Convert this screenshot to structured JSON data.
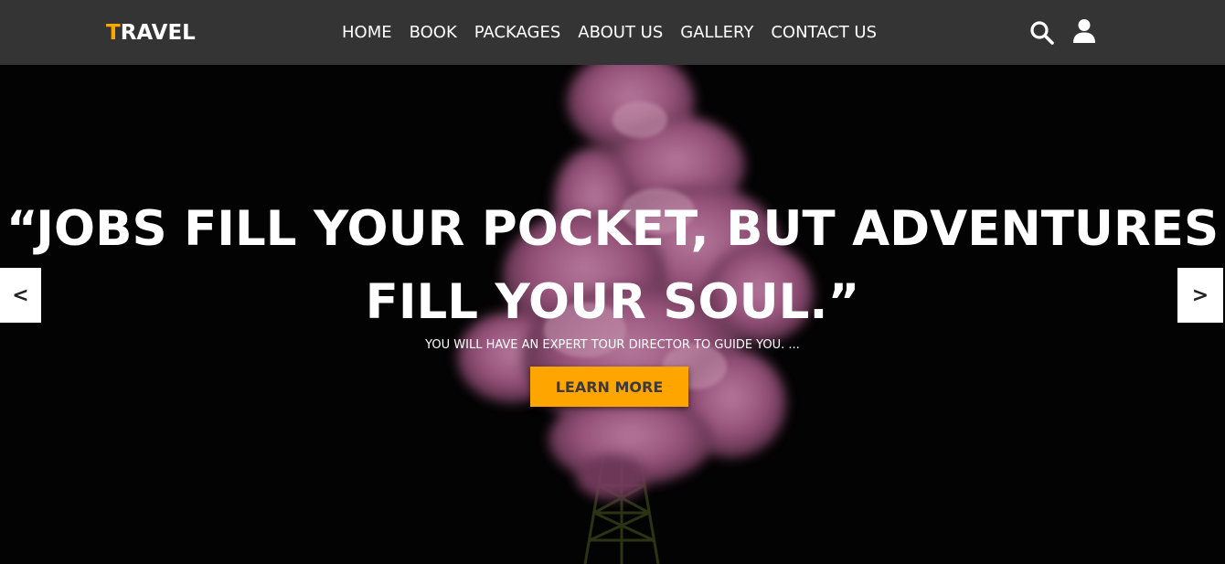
{
  "header": {
    "logo_first": "T",
    "logo_rest": "RAVEL",
    "nav": [
      {
        "label": "HOME"
      },
      {
        "label": "BOOK"
      },
      {
        "label": "PACKAGES"
      },
      {
        "label": "ABOUT US"
      },
      {
        "label": "GALLERY"
      },
      {
        "label": "CONTACT US"
      }
    ],
    "icons": [
      "search-icon",
      "user-icon"
    ]
  },
  "hero": {
    "title_line1": "“JOBS FILL YOUR POCKET, BUT ADVENTURES",
    "title_line2": "FILL YOUR SOUL.”",
    "subtitle": "YOU WILL HAVE AN EXPERT TOUR DIRECTOR TO GUIDE YOU. ...",
    "cta_label": "LEARN MORE",
    "prev_label": "<",
    "next_label": ">"
  },
  "colors": {
    "header_bg": "#343434",
    "accent": "#ffa500",
    "hero_bg": "#040404",
    "smoke": "#d77fb0"
  }
}
